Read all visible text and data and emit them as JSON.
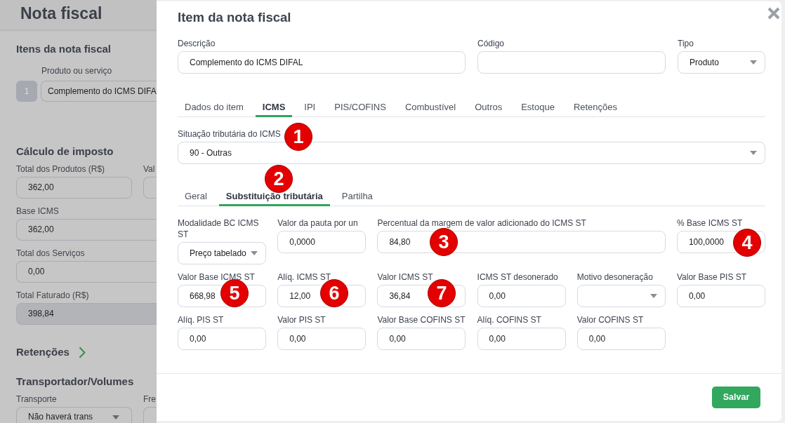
{
  "background": {
    "title": "Nota fiscal",
    "sections": [
      {
        "kind": "items",
        "heading": "Itens da nota fiscal",
        "column_label": "Produto ou serviço",
        "rows": [
          {
            "number": "1",
            "product": "Complemento do ICMS DIFA"
          }
        ]
      },
      {
        "kind": "fields",
        "heading": "Cálculo de imposto",
        "rows": [
          {
            "fields": [
              {
                "label": "Total dos Produtos (R$)",
                "value": "362,00",
                "kind": "input",
                "disabled": false
              },
              {
                "label": "Val",
                "kind": "input",
                "disabled": false
              }
            ]
          },
          {
            "fields": [
              {
                "label": "Base ICMS",
                "value": "362,00",
                "kind": "input",
                "disabled": false
              }
            ]
          },
          {
            "fields": [
              {
                "label": "Total dos Serviços",
                "value": "0,00",
                "kind": "input",
                "disabled": false
              }
            ]
          },
          {
            "fields": [
              {
                "label": "Total Faturado (R$)",
                "value": "398,84",
                "kind": "input",
                "disabled": true
              }
            ]
          }
        ]
      },
      {
        "kind": "toggle",
        "heading": "Retenções"
      },
      {
        "kind": "fields",
        "heading": "Transportador/Volumes",
        "rows": [
          {
            "fields": [
              {
                "label": "Transporte",
                "value": "Não haverá trans",
                "kind": "select",
                "disabled": false
              },
              {
                "label": "Fre",
                "kind": "input",
                "disabled": false
              }
            ]
          }
        ]
      }
    ]
  },
  "modal": {
    "title": "Item da nota fiscal",
    "header_fields": [
      {
        "label": "Descrição",
        "value": "Complemento do ICMS DIFAL",
        "kind": "input"
      },
      {
        "label": "Código",
        "kind": "input"
      },
      {
        "label": "Tipo",
        "value": "Produto",
        "kind": "select"
      }
    ],
    "tabs": [
      {
        "label": "Dados do item",
        "selected": false
      },
      {
        "label": "ICMS",
        "selected": true
      },
      {
        "label": "IPI",
        "selected": false
      },
      {
        "label": "PIS/COFINS",
        "selected": false
      },
      {
        "label": "Combustível",
        "selected": false
      },
      {
        "label": "Outros",
        "selected": false
      },
      {
        "label": "Estoque",
        "selected": false
      },
      {
        "label": "Retenções",
        "selected": false
      }
    ],
    "icms_situation": {
      "label": "Situação tributária do ICMS",
      "value": "90 - Outras",
      "kind": "select"
    },
    "subtabs": [
      {
        "label": "Geral",
        "selected": false
      },
      {
        "label": "Substituição tributária",
        "selected": true
      },
      {
        "label": "Partilha",
        "selected": false
      }
    ],
    "st_fields": [
      {
        "label": "Modalidade BC ICMS ST",
        "value": "Preço tabelado",
        "kind": "select"
      },
      {
        "label": "Valor da pauta por un",
        "value": "0,0000",
        "kind": "input"
      },
      {
        "label": "Percentual da margem de valor adicionado do ICMS ST",
        "value": "84,80",
        "kind": "input"
      },
      {
        "label": "% Base ICMS ST",
        "value": "100,0000",
        "kind": "input"
      },
      {
        "label": "Valor Base ICMS ST",
        "value": "668,98",
        "kind": "input"
      },
      {
        "label": "Alíq. ICMS ST",
        "value": "12,00",
        "kind": "input"
      },
      {
        "label": "Valor ICMS ST",
        "value": "36,84",
        "kind": "input"
      },
      {
        "label": "ICMS ST desonerado",
        "value": "0,00",
        "kind": "input"
      },
      {
        "label": "Motivo desoneração",
        "kind": "select"
      },
      {
        "label": "Valor Base PIS ST",
        "value": "0,00",
        "kind": "input"
      },
      {
        "label": "Alíq. PIS ST",
        "value": "0,00",
        "kind": "input"
      },
      {
        "label": "Valor PIS ST",
        "value": "0,00",
        "kind": "input"
      },
      {
        "label": "Valor Base COFINS ST",
        "value": "0,00",
        "kind": "input"
      },
      {
        "label": "Alíq. COFINS ST",
        "value": "0,00",
        "kind": "input"
      },
      {
        "label": "Valor COFINS ST",
        "value": "0,00",
        "kind": "input"
      }
    ],
    "save_button": "Salvar",
    "markers": [
      {
        "label": "1"
      },
      {
        "label": "2"
      },
      {
        "label": "3"
      },
      {
        "label": "4"
      },
      {
        "label": "5"
      },
      {
        "label": "6"
      },
      {
        "label": "7"
      }
    ]
  }
}
